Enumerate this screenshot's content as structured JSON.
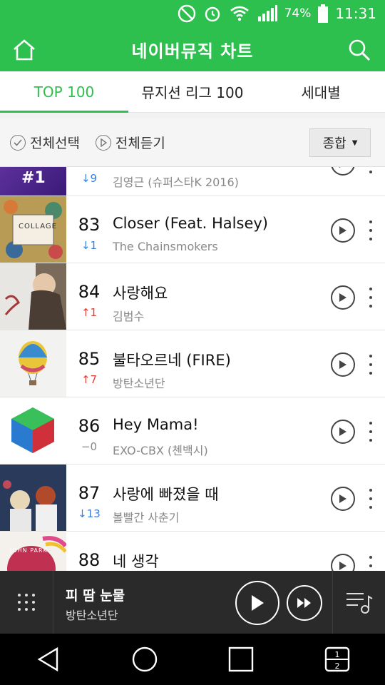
{
  "status_bar": {
    "battery": "74%",
    "time": "11:31"
  },
  "app": {
    "title": "네이버뮤직 차트"
  },
  "tabs": [
    {
      "label": "TOP 100",
      "active": true
    },
    {
      "label": "뮤지션 리그 100",
      "active": false
    },
    {
      "label": "세대별",
      "active": false
    }
  ],
  "toolbar": {
    "select_all": "전체선택",
    "play_all": "전체듣기",
    "sort": "종합"
  },
  "rows": [
    {
      "rank": "",
      "change": "9",
      "dir": "down",
      "title": "",
      "artist": "김영근 (슈퍼스타K 2016)",
      "art_text": "#1"
    },
    {
      "rank": "83",
      "change": "1",
      "dir": "down",
      "title": "Closer (Feat. Halsey)",
      "artist": "The Chainsmokers",
      "art_text": "COLLAGE"
    },
    {
      "rank": "84",
      "change": "1",
      "dir": "up",
      "title": "사랑해요",
      "artist": "김범수",
      "art_text": ""
    },
    {
      "rank": "85",
      "change": "7",
      "dir": "up",
      "title": "불타오르네 (FIRE)",
      "artist": "방탄소년단",
      "art_text": ""
    },
    {
      "rank": "86",
      "change": "0",
      "dir": "same",
      "title": "Hey Mama!",
      "artist": "EXO-CBX (첸백시)",
      "art_text": ""
    },
    {
      "rank": "87",
      "change": "13",
      "dir": "down",
      "title": "사랑에 빠졌을 때",
      "artist": "볼빨간 사춘기",
      "art_text": ""
    },
    {
      "rank": "88",
      "change": "",
      "dir": "none",
      "title": "네 생각",
      "artist": "",
      "art_text": "JOHN PARK"
    }
  ],
  "arrows": {
    "up": "↑",
    "down": "↓",
    "same": "−"
  },
  "player": {
    "title": "피 땀 눈물",
    "artist": "방탄소년단"
  },
  "colors": {
    "brand": "#2ec04f",
    "up": "#e0403a",
    "down": "#3a7ee0"
  }
}
